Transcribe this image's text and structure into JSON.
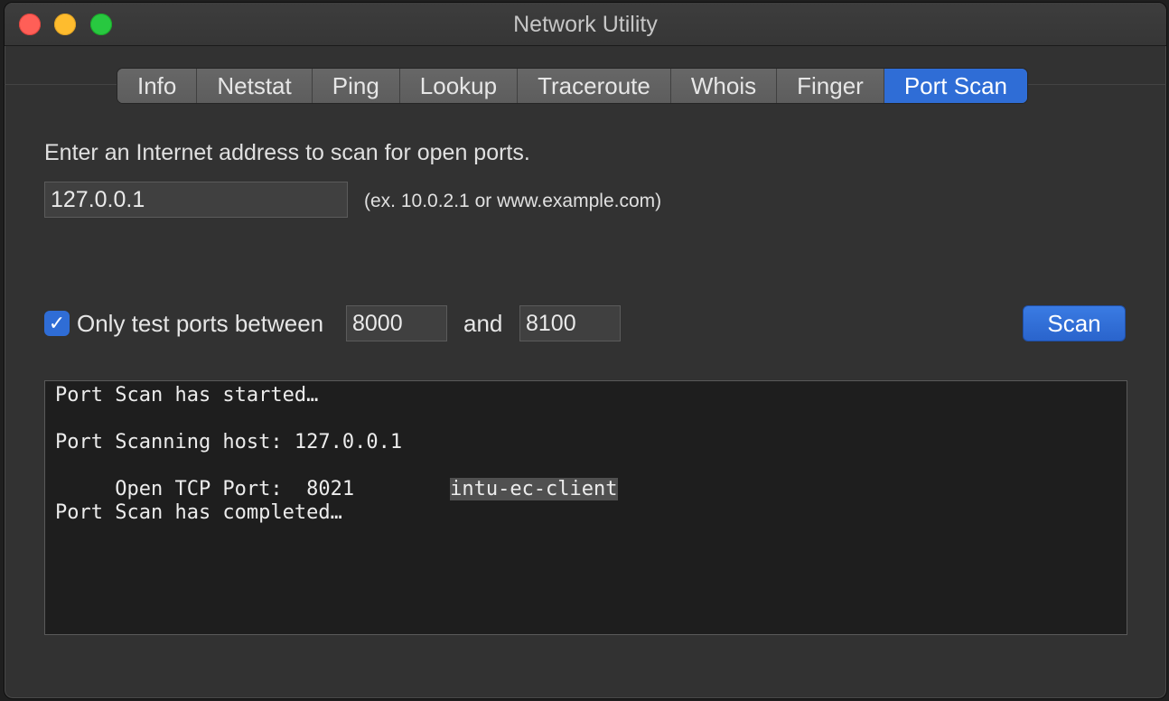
{
  "window": {
    "title": "Network Utility"
  },
  "tabs": [
    {
      "label": "Info",
      "active": false
    },
    {
      "label": "Netstat",
      "active": false
    },
    {
      "label": "Ping",
      "active": false
    },
    {
      "label": "Lookup",
      "active": false
    },
    {
      "label": "Traceroute",
      "active": false
    },
    {
      "label": "Whois",
      "active": false
    },
    {
      "label": "Finger",
      "active": false
    },
    {
      "label": "Port Scan",
      "active": true
    }
  ],
  "port_scan": {
    "prompt": "Enter an Internet address to scan for open ports.",
    "address_value": "127.0.0.1",
    "address_hint": "(ex. 10.0.2.1 or www.example.com)",
    "only_test_checked": true,
    "checkbox_glyph": "✓",
    "only_test_label": "Only test ports between",
    "port_start": "8000",
    "and_label": "and",
    "port_end": "8100",
    "scan_label": "Scan"
  },
  "output": {
    "started": "Port Scan has started…",
    "host": "Port Scanning host: 127.0.0.1",
    "open_port_prefix": "     Open TCP Port:  8021        ",
    "service": "intu-ec-client",
    "completed": "Port Scan has completed…"
  },
  "colors": {
    "accent": "#2f6dd6",
    "close": "#ff5f57",
    "minimize": "#febc2e",
    "zoom": "#28c840"
  }
}
